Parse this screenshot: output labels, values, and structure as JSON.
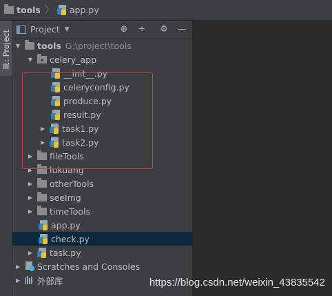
{
  "breadcrumb": {
    "root": "tools",
    "separator": "〉",
    "file": "app.py"
  },
  "side_strip": {
    "tab_label": "1: Project"
  },
  "panel": {
    "title": "Project",
    "dropdown_glyph": "▼",
    "buttons": {
      "locate": "⊕",
      "collapse": "÷",
      "settings": "⚙",
      "hide": "—"
    }
  },
  "tree": {
    "root": {
      "name": "tools",
      "path": "G:\\project\\tools"
    },
    "celery_app": {
      "name": "celery_app"
    },
    "celery_files": [
      {
        "name": "__init__.py"
      },
      {
        "name": "celeryconfig.py"
      },
      {
        "name": "produce.py"
      },
      {
        "name": "result.py"
      },
      {
        "name": "task1.py"
      },
      {
        "name": "task2.py"
      }
    ],
    "folders": [
      {
        "name": "fileTools"
      },
      {
        "name": "lukuang"
      },
      {
        "name": "otherTools"
      },
      {
        "name": "seeImg"
      },
      {
        "name": "timeTools"
      }
    ],
    "root_files": [
      {
        "name": "app.py"
      },
      {
        "name": "check.py"
      },
      {
        "name": "task.py"
      }
    ],
    "scratches": "Scratches and Consoles",
    "external_libs": "外部库"
  },
  "icons": {
    "expanded_arrow": "▼",
    "collapsed_arrow": "▶"
  },
  "colors": {
    "panel_bg": "#3c3f41",
    "editor_bg": "#2b2b2b",
    "selected_row": "#0d293e",
    "highlight_border": "#d33a3a"
  },
  "watermark": "https://blog.csdn.net/weixin_43835542"
}
